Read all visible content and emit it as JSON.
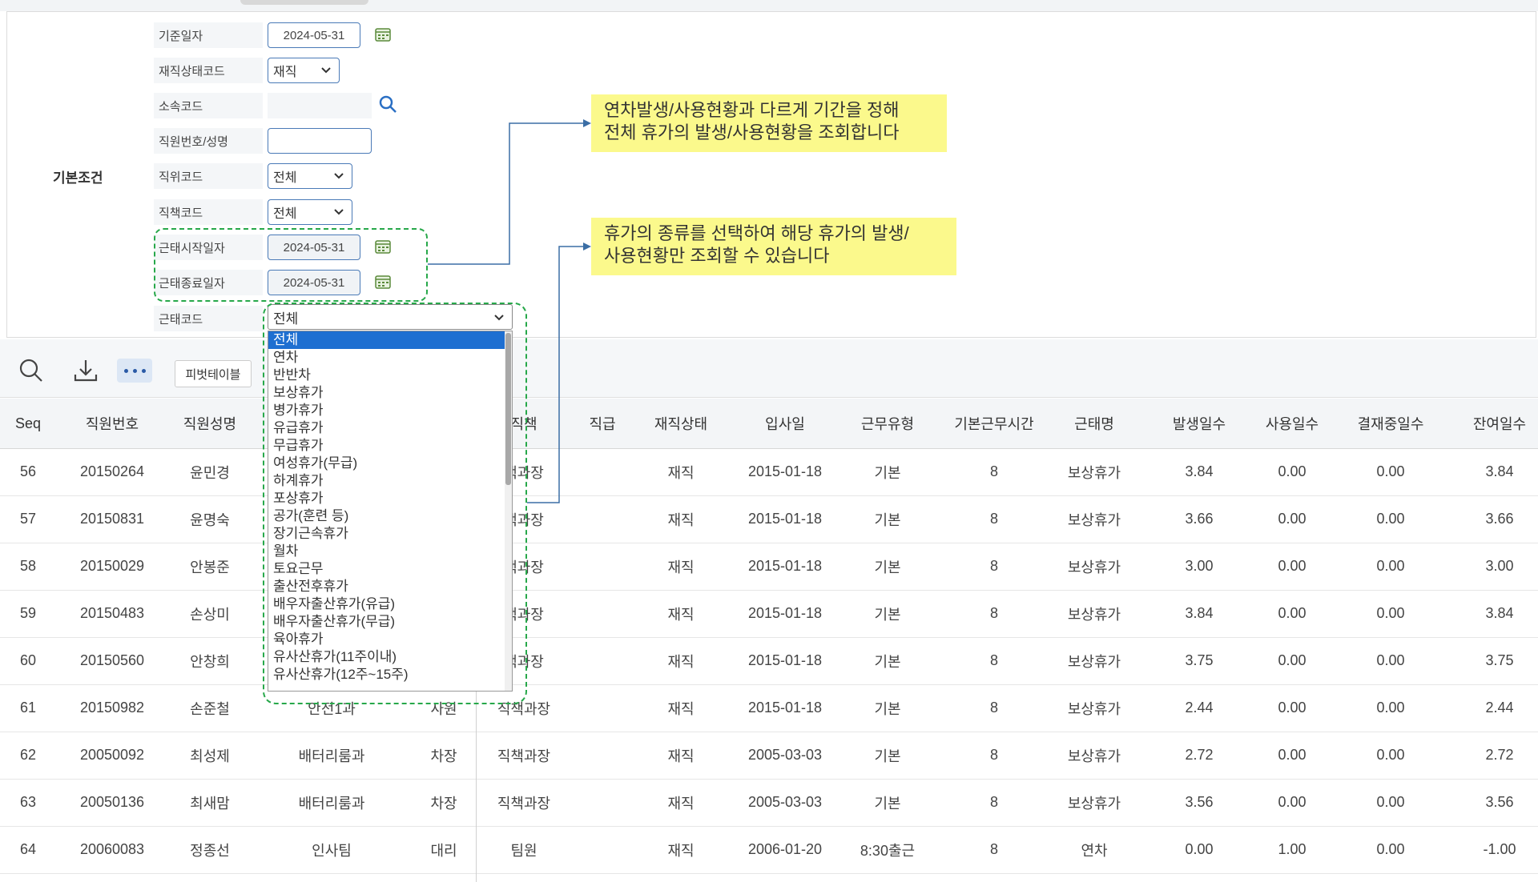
{
  "search": {
    "section_label": "기본조건",
    "labels": {
      "base_date": "기준일자",
      "employment_status": "재직상태코드",
      "dept_code": "소속코드",
      "employee": "직원번호/성명",
      "position_code": "직위코드",
      "title_code": "직책코드",
      "start_date": "근태시작일자",
      "end_date": "근태종료일자",
      "attendance_code": "근태코드"
    },
    "values": {
      "base_date": "2024-05-31",
      "employment_status": "재직",
      "dept_code": "",
      "employee": "",
      "position_code": "전체",
      "title_code": "전체",
      "start_date": "2024-05-31",
      "end_date": "2024-05-31",
      "attendance_code": "전체"
    },
    "attendance_options": [
      "전체",
      "연차",
      "반반차",
      "보상휴가",
      "병가휴가",
      "유급휴가",
      "무급휴가",
      "여성휴가(무급)",
      "하계휴가",
      "포상휴가",
      "공가(훈련 등)",
      "장기근속휴가",
      "월차",
      "토요근무",
      "출산전후휴가",
      "배우자출산휴가(유급)",
      "배우자출산휴가(무급)",
      "육아휴가",
      "유사산휴가(11주이내)",
      "유사산휴가(12주~15주)"
    ]
  },
  "callouts": {
    "date_range": [
      "연차발생/사용현황과 다르게 기간을 정해",
      "전체 휴가의 발생/사용현황을 조회합니다"
    ],
    "leave_type": [
      "휴가의 종류를 선택하여 해당 휴가의 발생/",
      "사용현황만 조회할 수 있습니다"
    ]
  },
  "toolbar": {
    "pivot_label": "피벗테이블"
  },
  "grid": {
    "columns": [
      "Seq",
      "직원번호",
      "직원성명",
      "",
      "",
      "직책",
      "직급",
      "재직상태",
      "입사일",
      "근무유형",
      "기본근무시간",
      "근태명",
      "발생일수",
      "사용일수",
      "결재중일수",
      "잔여일수"
    ],
    "rows": [
      [
        "56",
        "20150264",
        "윤민경",
        "",
        "",
        "책과장",
        "",
        "재직",
        "2015-01-18",
        "기본",
        "8",
        "보상휴가",
        "3.84",
        "0.00",
        "0.00",
        "3.84"
      ],
      [
        "57",
        "20150831",
        "윤명숙",
        "",
        "",
        "책과장",
        "",
        "재직",
        "2015-01-18",
        "기본",
        "8",
        "보상휴가",
        "3.66",
        "0.00",
        "0.00",
        "3.66"
      ],
      [
        "58",
        "20150029",
        "안봉준",
        "",
        "",
        "책과장",
        "",
        "재직",
        "2015-01-18",
        "기본",
        "8",
        "보상휴가",
        "3.00",
        "0.00",
        "0.00",
        "3.00"
      ],
      [
        "59",
        "20150483",
        "손상미",
        "",
        "",
        "책과장",
        "",
        "재직",
        "2015-01-18",
        "기본",
        "8",
        "보상휴가",
        "3.84",
        "0.00",
        "0.00",
        "3.84"
      ],
      [
        "60",
        "20150560",
        "안창희",
        "",
        "",
        "책과장",
        "",
        "재직",
        "2015-01-18",
        "기본",
        "8",
        "보상휴가",
        "3.75",
        "0.00",
        "0.00",
        "3.75"
      ],
      [
        "61",
        "20150982",
        "손준철",
        "안전1과",
        "사원",
        "직책과장",
        "",
        "재직",
        "2015-01-18",
        "기본",
        "8",
        "보상휴가",
        "2.44",
        "0.00",
        "0.00",
        "2.44"
      ],
      [
        "62",
        "20050092",
        "최성제",
        "배터리룸과",
        "차장",
        "직책과장",
        "",
        "재직",
        "2005-03-03",
        "기본",
        "8",
        "보상휴가",
        "2.72",
        "0.00",
        "0.00",
        "2.72"
      ],
      [
        "63",
        "20050136",
        "최새맘",
        "배터리룸과",
        "차장",
        "직책과장",
        "",
        "재직",
        "2005-03-03",
        "기본",
        "8",
        "보상휴가",
        "3.56",
        "0.00",
        "0.00",
        "3.56"
      ],
      [
        "64",
        "20060083",
        "정종선",
        "인사팀",
        "대리",
        "팀원",
        "",
        "재직",
        "2006-01-20",
        "8:30출근",
        "8",
        "연차",
        "0.00",
        "1.00",
        "0.00",
        "-1.00"
      ]
    ]
  },
  "colors": {
    "accent": "#1e6fd1",
    "callout": "#fbf98c",
    "dashed": "#27a84a",
    "connector": "#3b6ea5"
  }
}
